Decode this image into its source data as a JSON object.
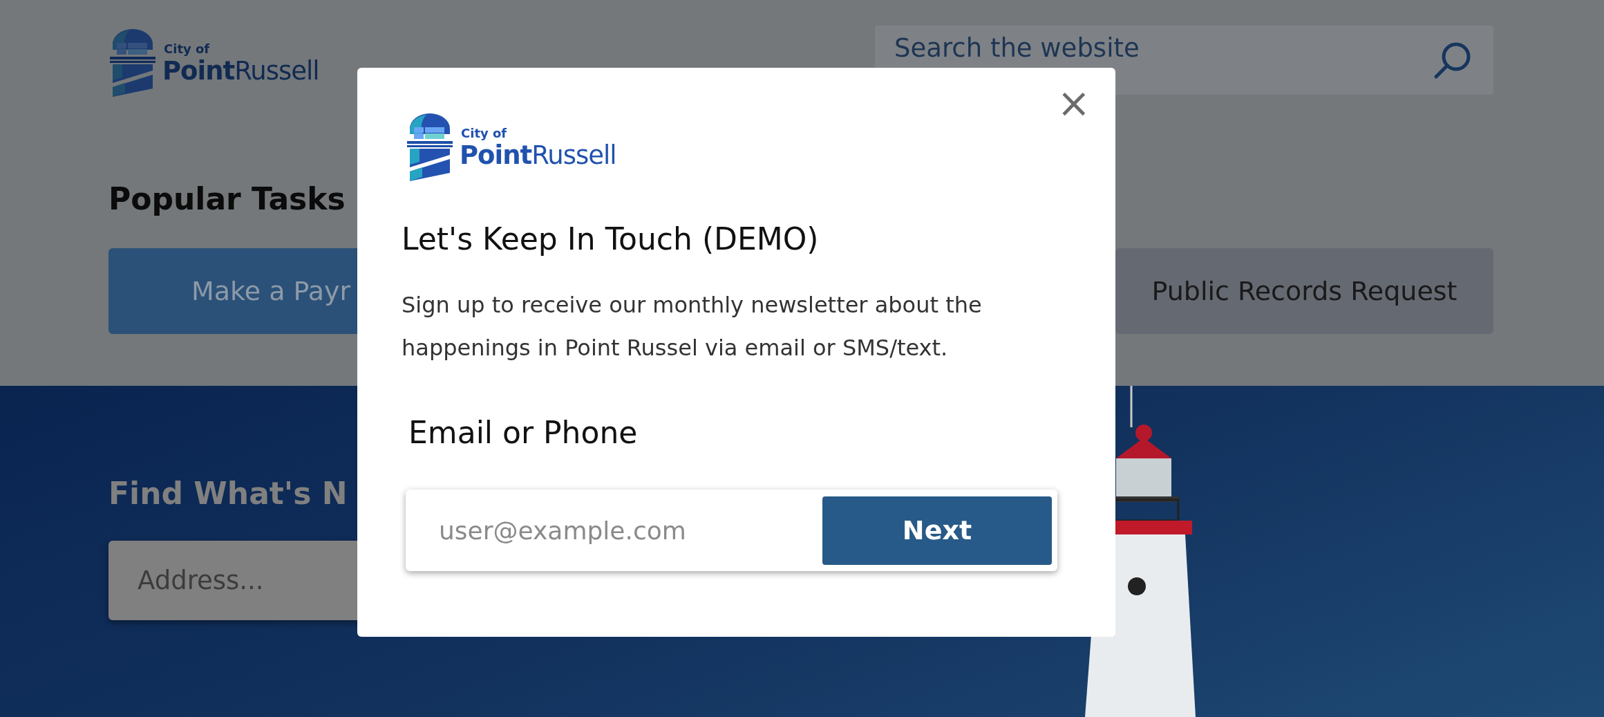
{
  "header": {
    "logo": {
      "tagline": "City of",
      "name": "**Point**Russell"
    },
    "search": {
      "placeholder": "Search the website"
    }
  },
  "popular_tasks": {
    "title": "Popular Tasks",
    "buttons": [
      {
        "label": "Make a Payr",
        "kind": "primary"
      },
      {
        "label": "Public Records Request",
        "kind": "secondary"
      }
    ]
  },
  "hero": {
    "title": "Find What's N",
    "address": {
      "placeholder": "Address..."
    }
  },
  "modal": {
    "logo": {
      "tagline": "City of",
      "name": "**Point**Russell"
    },
    "close": "×",
    "title": "Let's Keep In Touch (DEMO)",
    "text": "Sign up to receive our monthly newsletter about the happenings in Point Russel via email or SMS/text.",
    "field_label": "Email or Phone",
    "field": {
      "placeholder": "user@example.com"
    },
    "submit": "Next"
  }
}
